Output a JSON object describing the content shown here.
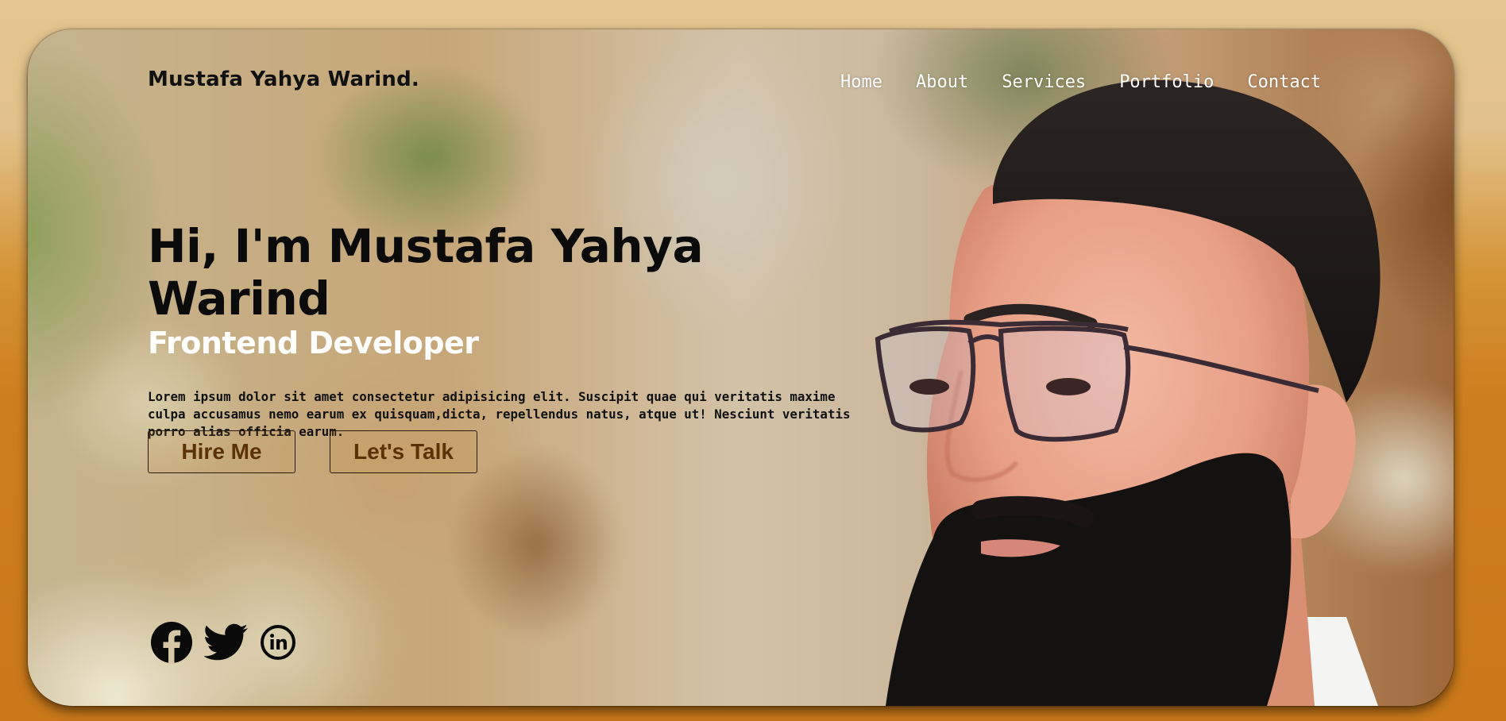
{
  "header": {
    "logo": "Mustafa Yahya Warind.",
    "nav": [
      "Home",
      "About",
      "Services",
      "Portfolio",
      "Contact"
    ]
  },
  "hero": {
    "title": "Hi, I'm Mustafa Yahya Warind",
    "subtitle": "Frontend Developer",
    "description": "Lorem ipsum dolor sit amet consectetur adipisicing elit. Suscipit quae qui veritatis maxime culpa accusamus nemo earum ex quisquam,dicta, repellendus natus, atque ut! Nesciunt veritatis porro alias officia earum.",
    "buttons": {
      "hire": "Hire Me",
      "talk": "Let's Talk"
    }
  },
  "socials": [
    "facebook-icon",
    "twitter-icon",
    "linkedin-icon"
  ],
  "colors": {
    "page_background": "#cd7f1e",
    "button_text": "#5a3205",
    "nav_text": "#ffffff",
    "subtitle_text": "#ffffff"
  }
}
